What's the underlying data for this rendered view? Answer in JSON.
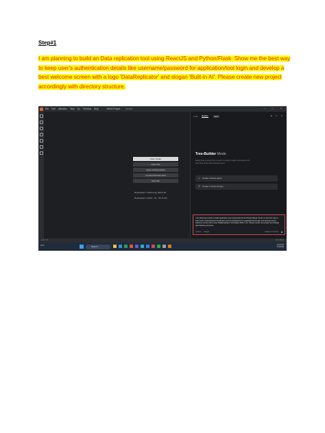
{
  "doc": {
    "step": "Step#1",
    "paragraph": "I am planning to build an Data replication tool using ReactJS and Python/Flask. Show me the best way to keep user's authentication details like username/password for application/tool login and develop a best welcome screen with a logo 'DataReplicator' and slogan 'Built-in AI'. Please create new project accordingly with directory structure."
  },
  "screenshot": {
    "menu": [
      "File",
      "Edit",
      "Selection",
      "View",
      "Go",
      "Terminal",
      "Help"
    ],
    "project": "Select Project",
    "search": "Search",
    "window_controls": "— ▢ ✕",
    "welcome_buttons": [
      "Open Folder",
      "Open File",
      "Clone Git Repository",
      "Connect Remote Host",
      "New File"
    ],
    "recent": [
      "ReplicaApp 1 (Welcome) [2019 11]",
      "ReplicaApp 1 (2019 - 02 - 06 16 23)"
    ],
    "panel": {
      "tabs": [
        "Chat",
        "Builder"
      ],
      "badge": "New",
      "tools": "⊕ ↻ ✕",
      "title_bold": "Tree-Builder",
      "title_mode": "Mode",
      "description": "Easily build a project from scratch or another model, we'll design and code files will be automatically saved.",
      "actions": [
        "Create a React game",
        "Create a To-Do list app"
      ],
      "chat_text": "I am planning to build an Data replication tool using ReactJS and Python/Flask. Show me the best way to keep user's authentication details like username/password for application/tool login and develop a best welcome screen with a logo 'DataReplicator' and slogan 'Built-in AI'. Please create new project accordingly with directory structure.",
      "chat_footer": [
        "Context",
        "Images"
      ],
      "model": "Claude 3.7 Sonnet"
    },
    "status_left": "⊗ 0 ⚠ 0",
    "status_right": "Ln 1  Col 1",
    "weather": "25°C",
    "taskbar_search": "Search",
    "time": "10:09 PM",
    "date": "3/11/2025"
  },
  "colors": {
    "highlight": "#ffff00",
    "red_text": "#e8141e",
    "ide_bg": "#1e1f22",
    "chat_border": "#d04a5a"
  }
}
